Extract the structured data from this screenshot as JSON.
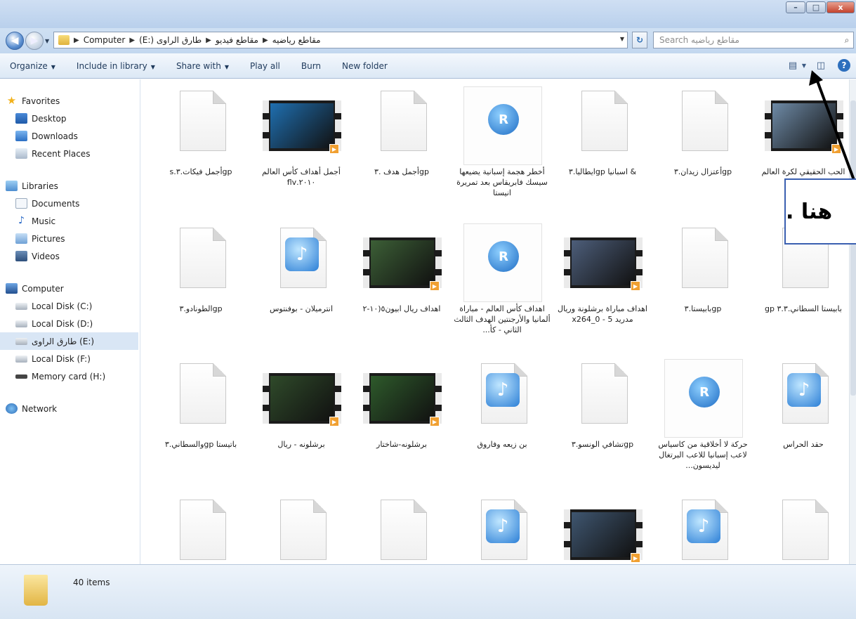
{
  "window": {
    "min_glyph": "–",
    "max_glyph": "□",
    "close_glyph": "x"
  },
  "address": {
    "breadcrumb": [
      "Computer",
      "(E:) طارق الراوى",
      "مقاطع فيديو",
      "مقاطع رياضيه"
    ],
    "search_placeholder": "Search مقاطع رياضيه"
  },
  "commands": [
    {
      "label": "Organize",
      "caret": true
    },
    {
      "label": "Include in library",
      "caret": true
    },
    {
      "label": "Share with",
      "caret": true
    },
    {
      "label": "Play all",
      "caret": false
    },
    {
      "label": "Burn",
      "caret": false
    },
    {
      "label": "New folder",
      "caret": false
    }
  ],
  "sidebar": {
    "favorites": {
      "label": "Favorites",
      "items": [
        "Desktop",
        "Downloads",
        "Recent Places"
      ]
    },
    "libraries": {
      "label": "Libraries",
      "items": [
        "Documents",
        "Music",
        "Pictures",
        "Videos"
      ]
    },
    "computer": {
      "label": "Computer",
      "items": [
        "Local Disk (C:)",
        "Local Disk (D:)",
        "طارق الراوى (E:)",
        "Local Disk (F:)",
        "Memory card (H:)"
      ]
    },
    "network": {
      "label": "Network"
    }
  },
  "files": [
    {
      "kind": "blank",
      "name": "gpأجمل فيكات.٣.s"
    },
    {
      "kind": "video",
      "name": "أجمل أهداف كأس العالم ٢٠١٠.flv",
      "scene": "#1f6fb0"
    },
    {
      "kind": "blank",
      "name": "gpأجمل هدف .٣"
    },
    {
      "kind": "real",
      "name": "أخطر هجمة إسبانية يضيعها سيسك فابريقاس بعد تمريرة انيستا"
    },
    {
      "kind": "blank",
      "name": "& اسبانيا gpايطاليا.٣"
    },
    {
      "kind": "blank",
      "name": "gpأعتزال زيدان.٣"
    },
    {
      "kind": "video",
      "name": "الحب الحقيقي لكرة العالم ولاعب",
      "scene": "#6e8aa6"
    },
    {
      "kind": "blank",
      "name": "gpالطونادو.٣"
    },
    {
      "kind": "audio",
      "name": "انترميلان - بوفنتوس"
    },
    {
      "kind": "video",
      "name": "اهداف ريال ابيون٥(١٠-٢",
      "scene": "#3c5f36"
    },
    {
      "kind": "real",
      "name": "اهداف كأس العالم - مباراة ألمانيا والأرجنتين الهدف الثالث الثاني - كأ..."
    },
    {
      "kind": "video",
      "name": "اهداف مباراة برشلونة وريال مدريد 5 - 0_x264",
      "scene": "#4d5e7a"
    },
    {
      "kind": "blank",
      "name": "gpبابيستا.٣"
    },
    {
      "kind": "blank",
      "name": "بابيستا السطاني.٣.٣ gp"
    },
    {
      "kind": "blank",
      "name": "باتيستا gpوالسطاني.٣"
    },
    {
      "kind": "video",
      "name": "برشلونه - ريال",
      "scene": "#2f4a2a"
    },
    {
      "kind": "video",
      "name": "برشلونه-شاختار",
      "scene": "#2e5a2b"
    },
    {
      "kind": "audio",
      "name": "بن زيعه وفاروق"
    },
    {
      "kind": "blank",
      "name": "gpتشافي الونسو.٣"
    },
    {
      "kind": "real",
      "name": "حركة لا أخلاقية من كاسياس لاعب إسبانيا للاعب البرتغال ليديسون..."
    },
    {
      "kind": "audio",
      "name": "حقد الحراس"
    },
    {
      "kind": "blank",
      "name": ""
    },
    {
      "kind": "blank",
      "name": ""
    },
    {
      "kind": "blank",
      "name": ""
    },
    {
      "kind": "audio",
      "name": ""
    },
    {
      "kind": "video",
      "name": "",
      "scene": "#3f5670"
    },
    {
      "kind": "audio",
      "name": ""
    },
    {
      "kind": "blank",
      "name": ""
    }
  ],
  "status": {
    "item_count": "40 items"
  },
  "annotation": {
    "text": "هنا ."
  },
  "colors": {
    "accent": "#2d6fbd",
    "callout_border": "#3a5fb0"
  }
}
